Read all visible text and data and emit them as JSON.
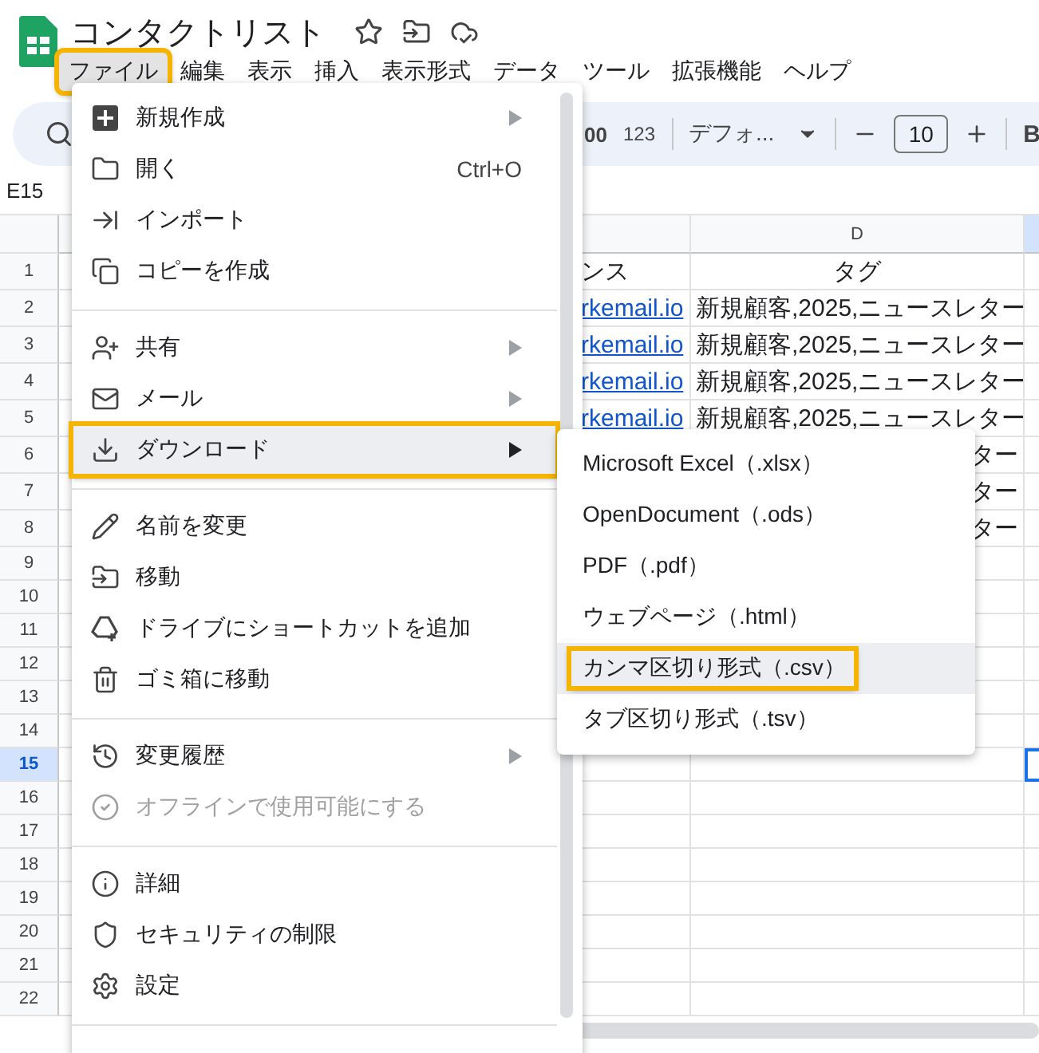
{
  "document": {
    "title": "コンタクトリスト"
  },
  "menubar": [
    {
      "label": "ファイル",
      "selected": true,
      "annotated": true
    },
    {
      "label": "編集",
      "selected": false,
      "annotated": false
    },
    {
      "label": "表示",
      "selected": false,
      "annotated": false
    },
    {
      "label": "挿入",
      "selected": false,
      "annotated": false
    },
    {
      "label": "表示形式",
      "selected": false,
      "annotated": false
    },
    {
      "label": "データ",
      "selected": false,
      "annotated": false
    },
    {
      "label": "ツール",
      "selected": false,
      "annotated": false
    },
    {
      "label": "拡張機能",
      "selected": false,
      "annotated": false
    },
    {
      "label": "ヘルプ",
      "selected": false,
      "annotated": false
    }
  ],
  "toolbar": {
    "decimal_label": "00",
    "format_label": "123",
    "font": "デフォ...",
    "font_size": "10",
    "bold_label": "B"
  },
  "name_box": "E15",
  "grid": {
    "columns": [
      {
        "label": "D",
        "selected": false
      },
      {
        "selected": true
      }
    ],
    "rows": [
      {
        "number": "1",
        "selected": false,
        "cells": [
          {
            "text": "ンス",
            "kind": "text"
          },
          {
            "text": "タグ",
            "kind": "header"
          }
        ]
      },
      {
        "number": "2",
        "selected": false,
        "cells": [
          {
            "text": "rkemail.io",
            "kind": "link"
          },
          {
            "text": "新規顧客,2025,ニュースレター",
            "kind": "text"
          }
        ]
      },
      {
        "number": "3",
        "selected": false,
        "cells": [
          {
            "text": "rkemail.io",
            "kind": "link"
          },
          {
            "text": "新規顧客,2025,ニュースレター",
            "kind": "text"
          }
        ]
      },
      {
        "number": "4",
        "selected": false,
        "cells": [
          {
            "text": "rkemail.io",
            "kind": "link"
          },
          {
            "text": "新規顧客,2025,ニュースレター",
            "kind": "text"
          }
        ]
      },
      {
        "number": "5",
        "selected": false,
        "cells": [
          {
            "text": "rkemail.io",
            "kind": "link"
          },
          {
            "text": "新規顧客,2025,ニュースレター",
            "kind": "text"
          }
        ]
      },
      {
        "number": "6",
        "selected": false,
        "cells": [
          {
            "text": "ター",
            "kind": "clipped"
          }
        ]
      },
      {
        "number": "7",
        "selected": false,
        "cells": [
          {
            "text": "ター",
            "kind": "clipped"
          }
        ]
      },
      {
        "number": "8",
        "selected": false,
        "cells": [
          {
            "text": "ター",
            "kind": "clipped"
          }
        ]
      },
      {
        "number": "9",
        "selected": false
      },
      {
        "number": "10",
        "selected": false
      },
      {
        "number": "11",
        "selected": false
      },
      {
        "number": "12",
        "selected": false
      },
      {
        "number": "13",
        "selected": false
      },
      {
        "number": "14",
        "selected": false
      },
      {
        "number": "15",
        "selected": true
      },
      {
        "number": "16",
        "selected": false
      },
      {
        "number": "17",
        "selected": false
      },
      {
        "number": "18",
        "selected": false
      },
      {
        "number": "19",
        "selected": false
      },
      {
        "number": "20",
        "selected": false
      },
      {
        "number": "21",
        "selected": false
      },
      {
        "number": "22",
        "selected": false
      }
    ]
  },
  "file_menu": {
    "sections": [
      [
        {
          "label": "新規作成",
          "submenu": true,
          "selected": false,
          "disabled": false,
          "annotated": false
        },
        {
          "label": "開く",
          "shortcut": "Ctrl+O",
          "submenu": false,
          "selected": false,
          "disabled": false,
          "annotated": false
        },
        {
          "label": "インポート",
          "submenu": false,
          "selected": false,
          "disabled": false,
          "annotated": false
        },
        {
          "label": "コピーを作成",
          "submenu": false,
          "selected": false,
          "disabled": false,
          "annotated": false
        }
      ],
      [
        {
          "label": "共有",
          "submenu": true,
          "selected": false,
          "disabled": false,
          "annotated": false
        },
        {
          "label": "メール",
          "submenu": true,
          "selected": false,
          "disabled": false,
          "annotated": false
        },
        {
          "label": "ダウンロード",
          "submenu": true,
          "selected": true,
          "disabled": false,
          "annotated": true
        }
      ],
      [
        {
          "label": "名前を変更",
          "submenu": false,
          "selected": false,
          "disabled": false,
          "annotated": false
        },
        {
          "label": "移動",
          "submenu": false,
          "selected": false,
          "disabled": false,
          "annotated": false
        },
        {
          "label": "ドライブにショートカットを追加",
          "submenu": false,
          "selected": false,
          "disabled": false,
          "annotated": false
        },
        {
          "label": "ゴミ箱に移動",
          "submenu": false,
          "selected": false,
          "disabled": false,
          "annotated": false
        }
      ],
      [
        {
          "label": "変更履歴",
          "submenu": true,
          "selected": false,
          "disabled": false,
          "annotated": false
        },
        {
          "label": "オフラインで使用可能にする",
          "submenu": false,
          "selected": false,
          "disabled": true,
          "annotated": false
        }
      ],
      [
        {
          "label": "詳細",
          "submenu": false,
          "selected": false,
          "disabled": false,
          "annotated": false
        },
        {
          "label": "セキュリティの制限",
          "submenu": false,
          "selected": false,
          "disabled": false,
          "annotated": false
        },
        {
          "label": "設定",
          "submenu": false,
          "selected": false,
          "disabled": false,
          "annotated": false
        }
      ]
    ]
  },
  "download_menu": [
    {
      "label": "Microsoft Excel（.xlsx）",
      "selected": false,
      "annotated": false
    },
    {
      "label": "OpenDocument（.ods）",
      "selected": false,
      "annotated": false
    },
    {
      "label": "PDF（.pdf）",
      "selected": false,
      "annotated": false
    },
    {
      "label": "ウェブページ（.html）",
      "selected": false,
      "annotated": false
    },
    {
      "label": "カンマ区切り形式（.csv）",
      "selected": true,
      "annotated": true
    },
    {
      "label": "タブ区切り形式（.tsv）",
      "selected": false,
      "annotated": false
    }
  ]
}
